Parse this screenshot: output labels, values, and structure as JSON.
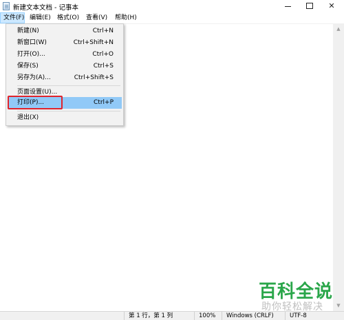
{
  "window": {
    "title": "新建文本文档 - 记事本",
    "minimize": "—",
    "close": "✕"
  },
  "menubar": {
    "file": "文件(F)",
    "edit": "编辑(E)",
    "format": "格式(O)",
    "view": "查看(V)",
    "help": "帮助(H)"
  },
  "file_menu": {
    "items": [
      {
        "label": "新建(N)",
        "shortcut": "Ctrl+N"
      },
      {
        "label": "新窗口(W)",
        "shortcut": "Ctrl+Shift+N"
      },
      {
        "label": "打开(O)...",
        "shortcut": "Ctrl+O"
      },
      {
        "label": "保存(S)",
        "shortcut": "Ctrl+S"
      },
      {
        "label": "另存为(A)...",
        "shortcut": "Ctrl+Shift+S"
      },
      {
        "label": "页面设置(U)...",
        "shortcut": ""
      },
      {
        "label": "打印(P)...",
        "shortcut": "Ctrl+P"
      },
      {
        "label": "退出(X)",
        "shortcut": ""
      }
    ]
  },
  "statusbar": {
    "position": "第 1 行，第 1 列",
    "zoom": "100%",
    "line_ending": "Windows (CRLF)",
    "encoding": "UTF-8"
  },
  "watermark": {
    "brand": "百科全说",
    "slogan": "助你轻松解决"
  },
  "colors": {
    "menu_highlight": "#91c9f7",
    "annotation_box": "#e0232b",
    "watermark_green": "#2aa64a"
  }
}
